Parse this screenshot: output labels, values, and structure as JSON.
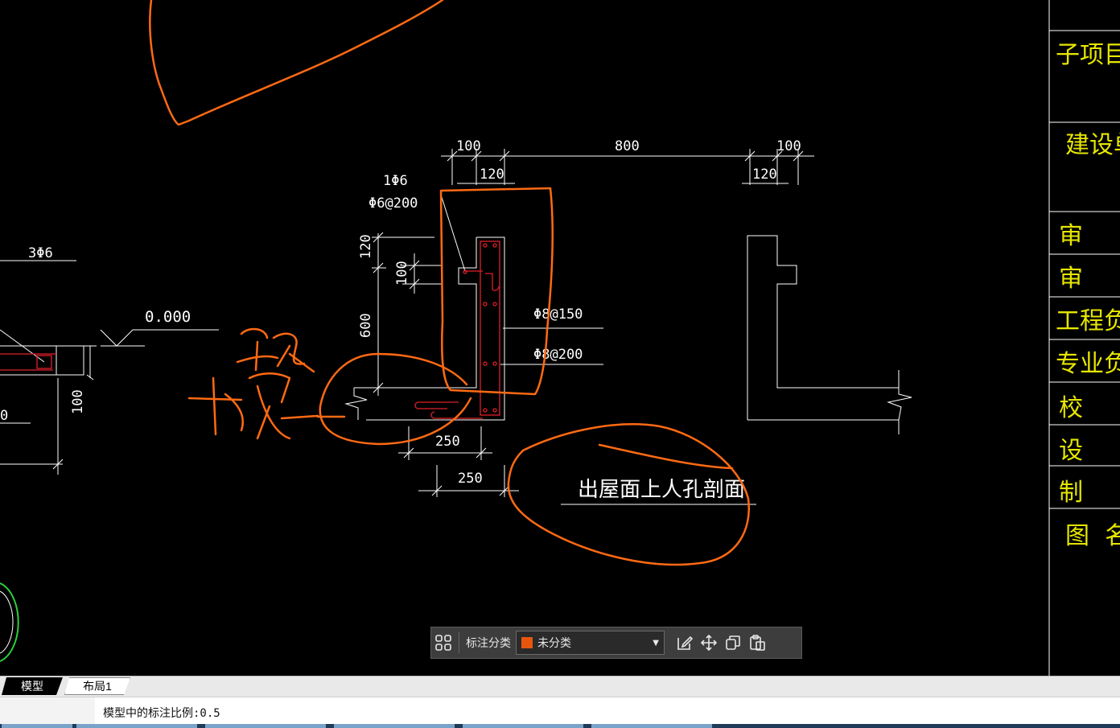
{
  "drawing": {
    "dimensions": {
      "top_100_left": "100",
      "top_800": "800",
      "top_100_right": "100",
      "top_120_left": "120",
      "top_120_right": "120",
      "bottom_250_a": "250",
      "bottom_250_b": "250",
      "side_120": "120",
      "side_100": "100",
      "side_600": "600",
      "left_100": "100"
    },
    "rebar_labels": {
      "one_phi6": "1Φ6",
      "phi6_at200": "Φ6@200",
      "phi8_at150": "Φ8@150",
      "phi8_at200": "Φ8@200",
      "three_phi6": "3Φ6"
    },
    "elevation": "0.000",
    "section_title": "出屋面上人孔剖面",
    "left_partial_text": "0",
    "colors": {
      "background": "#000000",
      "lines": "#ffffff",
      "markup": "#ff6a13",
      "rebar": "#e0202a",
      "titleblock": "#e6e600",
      "circle_green": "#2bd13a"
    }
  },
  "title_block": {
    "rows": [
      "子项目名",
      "建设单位",
      "审",
      "审",
      "工程负",
      "专业负",
      "校",
      "设",
      "制",
      "图  名"
    ]
  },
  "annotation_toolbar": {
    "label": "标注分类",
    "selected_category": "未分类",
    "swatch_color": "#e8560e"
  },
  "tabs": {
    "model": "模型",
    "layout1": "布局1"
  },
  "command_line": {
    "text": "模型中的标注比例:0.5"
  }
}
